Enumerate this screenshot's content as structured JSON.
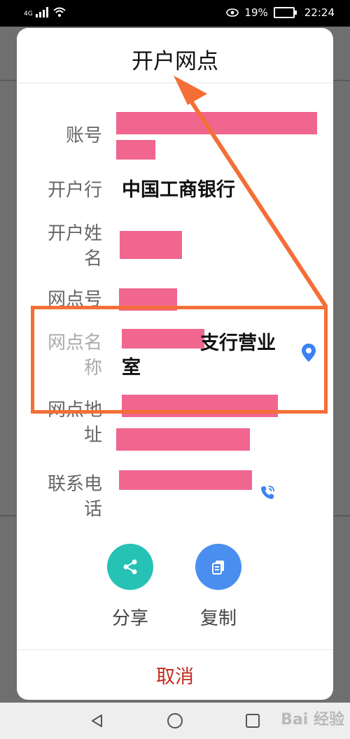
{
  "status_bar": {
    "network": "4G",
    "battery": "19%",
    "time": "22:24"
  },
  "dialog": {
    "title": "开户网点",
    "fields": [
      {
        "label": "账号",
        "value": ""
      },
      {
        "label": "开户行",
        "value": "中国工商银行"
      },
      {
        "label_line1": "开户姓",
        "label_line2": "名",
        "value": ""
      },
      {
        "label": "网点号",
        "value": ""
      },
      {
        "label_line1": "网点名",
        "label_line2": "称",
        "value_line1": "支行营业",
        "value_line2": "室"
      },
      {
        "label_line1": "网点地",
        "label_line2": "址",
        "value": ""
      },
      {
        "label_line1": "联系电",
        "label_line2": "话",
        "value": ""
      }
    ],
    "actions": {
      "share": {
        "label": "分享",
        "color": "#25c2b5"
      },
      "copy": {
        "label": "复制",
        "color": "#4a8ef0"
      }
    },
    "cancel_label": "取消"
  },
  "icons": {
    "location": "location-pin-icon",
    "phone": "phone-icon",
    "share": "share-icon",
    "copy": "copy-icon"
  },
  "colors": {
    "redaction": "#f0668f",
    "annotation": "#f36f36",
    "cancel": "#c22a20",
    "accent_blue": "#3b82f6"
  },
  "watermark": "Bai 经验"
}
